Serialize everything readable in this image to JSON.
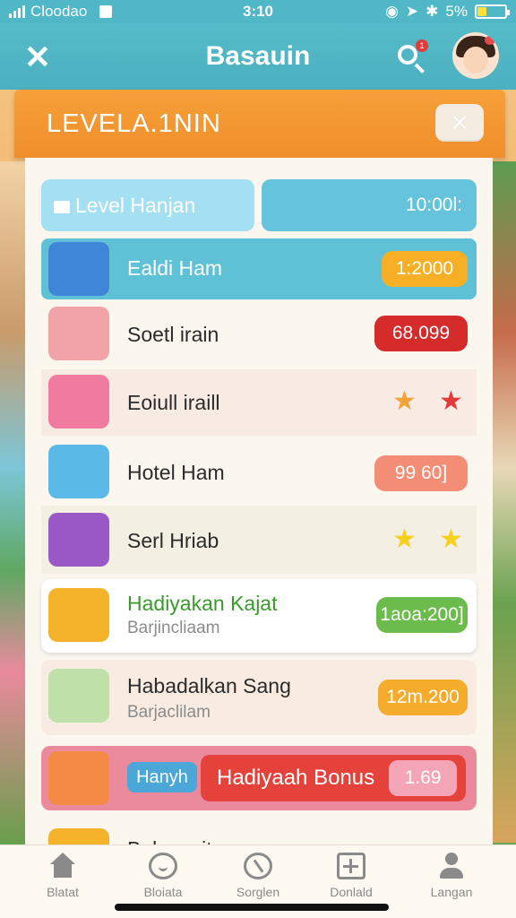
{
  "status_bar": {
    "carrier": "Cloodao",
    "time": "3:10",
    "battery": "5%",
    "battery_level": 0.3
  },
  "header": {
    "back_icon": "back-arrow-icon",
    "title": "Basauin",
    "search_badge": "1"
  },
  "modal": {
    "title": "LEVELA.1NIN",
    "close_symbol": "×"
  },
  "tabs": {
    "level_label": "Level Hanjan",
    "value": "10:00l:"
  },
  "rows": [
    {
      "label": "Ealdi Ham",
      "value": "1:2000"
    },
    {
      "label": "Soetl irain",
      "value": "68.099"
    },
    {
      "label": "Eoiull iraill",
      "stars": [
        "★",
        "★"
      ],
      "star_colors": [
        "#f2a23a",
        "#e23a3a"
      ]
    },
    {
      "label": "Hotel Ham",
      "value": "99 60]"
    },
    {
      "label": "Serl Hriab",
      "stars": [
        "★",
        "★"
      ],
      "star_colors": [
        "#f7cf1e",
        "#f7cf1e"
      ]
    },
    {
      "label": "Hadiyakan Kajat",
      "sub": "Barjincliaam",
      "value": "1aoa:200]"
    },
    {
      "label": "Habadalkan Sang",
      "sub": "Barjaclilam",
      "value": "12m.200"
    },
    {
      "tag": "Hanyh",
      "label": "Hadiyaah Bonus",
      "value": "1.69"
    },
    {
      "label": "Bolsanuit"
    }
  ],
  "bottom_nav": [
    {
      "label": "Blatat",
      "icon": "home-icon"
    },
    {
      "label": "Bloiata",
      "icon": "bell-icon"
    },
    {
      "label": "Sorglen",
      "icon": "wrench-icon"
    },
    {
      "label": "Donlald",
      "icon": "plus-icon"
    },
    {
      "label": "Langan",
      "icon": "user-icon"
    }
  ]
}
